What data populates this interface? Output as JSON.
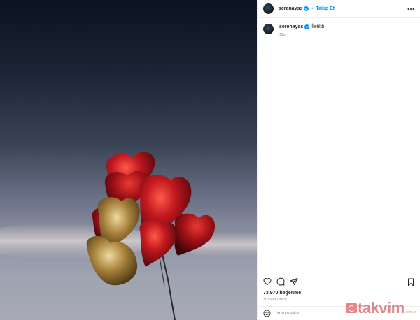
{
  "post": {
    "username": "serenayss",
    "follow_label": "Takip Et",
    "separator": "•",
    "caption_text": "İletildi.",
    "caption_time": "11s",
    "likes_count": "73.970",
    "likes_label": "beğenme",
    "posted_ago": "11 SAAT ÖNCE",
    "comment_placeholder": "Yorum ekle..."
  },
  "watermark": {
    "brand": "takvim",
    "suffix": ".com.tr"
  },
  "icons": {
    "more": "more-options-icon",
    "verified": "verified-badge-icon",
    "like": "heart-icon",
    "comment": "comment-icon",
    "share": "share-icon",
    "save": "bookmark-icon",
    "emoji": "emoji-icon"
  },
  "colors": {
    "accent": "#0095f6",
    "verified": "#0095f6",
    "balloon_red": "#b3141c",
    "balloon_gold": "#b08a3a",
    "watermark_red": "#c8282f"
  }
}
